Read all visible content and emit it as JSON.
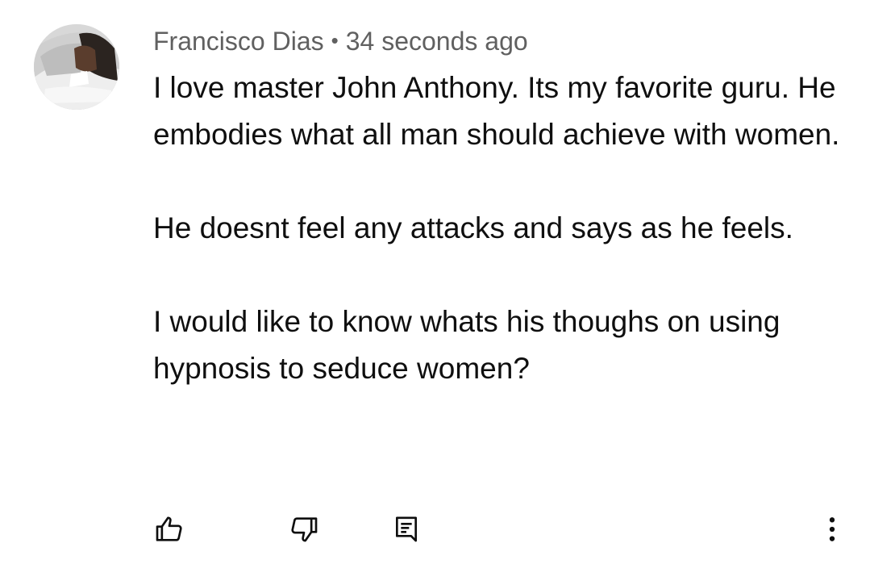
{
  "comment": {
    "author": "Francisco Dias",
    "separator": "•",
    "timestamp": "34 seconds ago",
    "paragraphs": [
      "I love master John Anthony. Its my favorite guru. He embodies what all man should achieve with women.",
      "He doesnt feel any attacks and says as he feels.",
      "I would like to know whats his thoughs on using hypnosis to seduce women?"
    ]
  },
  "icons": {
    "like": "thumb-up-icon",
    "dislike": "thumb-down-icon",
    "reply": "reply-comment-icon",
    "more": "more-vert-icon"
  },
  "colors": {
    "text": "#0f0f0f",
    "meta": "#606060",
    "icon": "#0f0f0f",
    "background": "#ffffff"
  }
}
